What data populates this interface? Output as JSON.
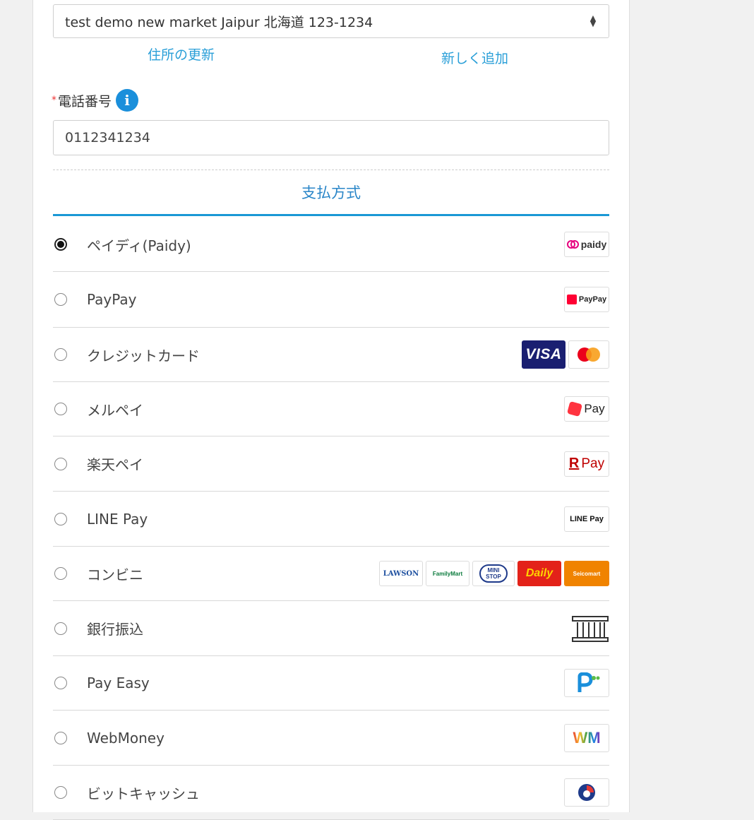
{
  "address": {
    "selected": "test demo new market Jaipur 北海道 123-1234",
    "update_link": "住所の更新",
    "add_link": "新しく追加"
  },
  "phone": {
    "required_mark": "*",
    "label": "電話番号",
    "info_glyph": "i",
    "value": "0112341234"
  },
  "payment": {
    "title": "支払方式",
    "methods": [
      {
        "label": "ペイディ(Paidy)",
        "checked": true,
        "logos": [
          {
            "icon": "paidy-logo",
            "text": "paidy"
          }
        ]
      },
      {
        "label": "PayPay",
        "checked": false,
        "logos": [
          {
            "icon": "paypay-logo",
            "text": "PayPay"
          }
        ]
      },
      {
        "label": "クレジットカード",
        "checked": false,
        "logos": [
          {
            "icon": "visa-logo",
            "text": "VISA"
          },
          {
            "icon": "mastercard-logo",
            "text": ""
          }
        ]
      },
      {
        "label": "メルペイ",
        "checked": false,
        "logos": [
          {
            "icon": "merpay-logo",
            "text": "Pay"
          }
        ]
      },
      {
        "label": "楽天ペイ",
        "checked": false,
        "logos": [
          {
            "icon": "rakuten-pay-logo",
            "text": "Pay"
          }
        ]
      },
      {
        "label": "LINE Pay",
        "checked": false,
        "logos": [
          {
            "icon": "line-pay-logo",
            "text": "LINE Pay"
          }
        ]
      },
      {
        "label": "コンビニ",
        "checked": false,
        "logos": [
          {
            "icon": "lawson-logo",
            "text": "LAWSON"
          },
          {
            "icon": "familymart-logo",
            "text": "FamilyMart"
          },
          {
            "icon": "ministop-logo",
            "text": "MINI STOP"
          },
          {
            "icon": "daily-logo",
            "text": "Daily"
          },
          {
            "icon": "seicomart-logo",
            "text": "Seicomart"
          }
        ]
      },
      {
        "label": "銀行振込",
        "checked": false,
        "logos": [
          {
            "icon": "bank-icon",
            "text": ""
          }
        ]
      },
      {
        "label": "Pay Easy",
        "checked": false,
        "logos": [
          {
            "icon": "payeasy-logo",
            "text": ""
          }
        ]
      },
      {
        "label": "WebMoney",
        "checked": false,
        "logos": [
          {
            "icon": "webmoney-logo",
            "text": "WM"
          }
        ]
      },
      {
        "label": "ビットキャッシュ",
        "checked": false,
        "logos": [
          {
            "icon": "bitcash-logo",
            "text": ""
          }
        ]
      }
    ]
  },
  "colors": {
    "accent": "#1a98d5",
    "link": "#2a9fd8",
    "visa": "#1a1f71",
    "rakuten": "#bf0000",
    "line": "#06c755",
    "daily": "#e32219",
    "seicomart": "#f08300",
    "paypay": "#ff0033"
  }
}
